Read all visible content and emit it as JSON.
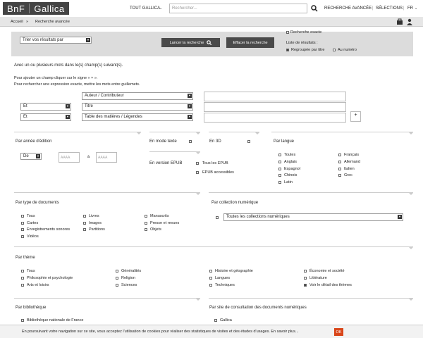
{
  "header": {
    "logo_left": "BnF",
    "logo_right": "Gallica",
    "scope": "TOUT GALLICA",
    "search_placeholder": "Rechercher...",
    "advanced": "RECHERCHE AVANCÉE",
    "selections": "SÉLECTIONS",
    "lang": "FR"
  },
  "breadcrumb": {
    "home": "Accueil",
    "sep": "»",
    "current": "Recherche avancée"
  },
  "topbar": {
    "sort": "Trier vos résultats par",
    "launch": "Lancer la recherche",
    "clear": "Effacer la recherche",
    "exact": "Recherche exacte",
    "list_label": "Liste de résultats :",
    "grouped": "Regroupée par titre",
    "by_issue": "Au numéro"
  },
  "words": {
    "title": "Avec un ou plusieurs mots dans le(s) champ(s) suivant(s).",
    "help1": "Pour ajouter un champ cliquer sur le signe « + ».",
    "help2": "Pour rechercher une expression exacte, mettre les mots entre guillemets.",
    "field1": "Auteur / Contributeur",
    "op2": "Et",
    "field2": "Titre",
    "op3": "Et",
    "field3": "Table des matières / Légendes",
    "plus": "+"
  },
  "year": {
    "title": "Par année d'édition",
    "op": "De",
    "ph1": "AAAA",
    "and": "à",
    "ph2": "AAAA"
  },
  "mode": {
    "text": "En mode texte",
    "epub": "En version EPUB",
    "all_epub": "Tous les EPUB",
    "epub_access": "EPUB accessibles",
    "threed": "En 3D"
  },
  "lang": {
    "title": "Par langue",
    "items": [
      "Toutes",
      "Anglais",
      "Espagnol",
      "Chinois",
      "Latin",
      "Français",
      "Allemand",
      "Italien",
      "Grec"
    ]
  },
  "doctype": {
    "title": "Par type de documents",
    "col1": [
      "Tous",
      "Cartes",
      "Enregistrements sonores",
      "Vidéos"
    ],
    "col2": [
      "Livres",
      "Images",
      "Partitions"
    ],
    "col3": [
      "Manuscrits",
      "Presse et revues",
      "Objets"
    ]
  },
  "collection": {
    "title": "Par collection numérique",
    "value": "Toutes les collections numériques"
  },
  "theme": {
    "title": "Par thème",
    "col1": [
      "Tous",
      "Philosophie et psychologie",
      "Arts et loisirs"
    ],
    "col2": [
      "Généralités",
      "Religion",
      "Sciences"
    ],
    "col3": [
      "Histoire et géographie",
      "Langues",
      "Techniques"
    ],
    "col4": [
      "Économie et société",
      "Littérature",
      "Voir le détail des thèmes"
    ]
  },
  "library": {
    "title": "Par bibliothèque",
    "item": "Bibliothèque nationale de France"
  },
  "site": {
    "title": "Par site de consultation des documents numériques",
    "item": "Gallica"
  },
  "cookie": {
    "text": "En poursuivant votre navigation sur ce site, vous acceptez l'utilisation de cookies pour réaliser des statistiques de visites et des études d'usages. En savoir plus...",
    "ok": "OK"
  }
}
